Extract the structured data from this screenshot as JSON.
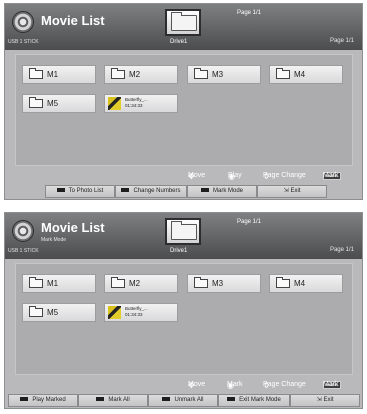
{
  "screen1": {
    "title": "Movie List",
    "subtitle": "",
    "device": "USB 1 STICK",
    "page_top": "Page 1/1",
    "page_right": "Page 1/1",
    "drive_label": "Drive1",
    "folders": [
      {
        "label": "M1"
      },
      {
        "label": "M2"
      },
      {
        "label": "M3"
      },
      {
        "label": "M4"
      },
      {
        "label": "M5"
      }
    ],
    "video": {
      "name": "Butterfly_...",
      "duration": "01:34:33"
    },
    "nav": {
      "move": "Move",
      "play": "Play",
      "page_change": "Page Change",
      "mark_key": "MARK",
      "mark": "Mark"
    },
    "buttons": {
      "b1": "To Photo List",
      "b2": "Change Numbers",
      "b3": "Mark Mode",
      "b4": "Exit"
    }
  },
  "screen2": {
    "title": "Movie List",
    "subtitle": "Mark Mode",
    "device": "USB 1 STICK",
    "page_top": "Page 1/1",
    "page_right": "Page 1/1",
    "drive_label": "Drive1",
    "folders": [
      {
        "label": "M1"
      },
      {
        "label": "M2"
      },
      {
        "label": "M3"
      },
      {
        "label": "M4"
      },
      {
        "label": "M5"
      }
    ],
    "video": {
      "name": "Butterfly_...",
      "duration": "01:34:33"
    },
    "nav": {
      "move": "Move",
      "mark": "Mark",
      "page_change": "Page Change",
      "mark_key": "MARK",
      "mark2": "Mark"
    },
    "buttons": {
      "b1": "Play Marked",
      "b2": "Mark All",
      "b3": "Unmark All",
      "b4": "Exit Mark Mode",
      "b5": "Exit"
    }
  },
  "icons": {
    "disc": "disc-icon",
    "folder": "folder-icon",
    "move": "dpad-icon",
    "play": "ok-icon",
    "page_change": "channel-icon",
    "exit": "exit-icon"
  }
}
